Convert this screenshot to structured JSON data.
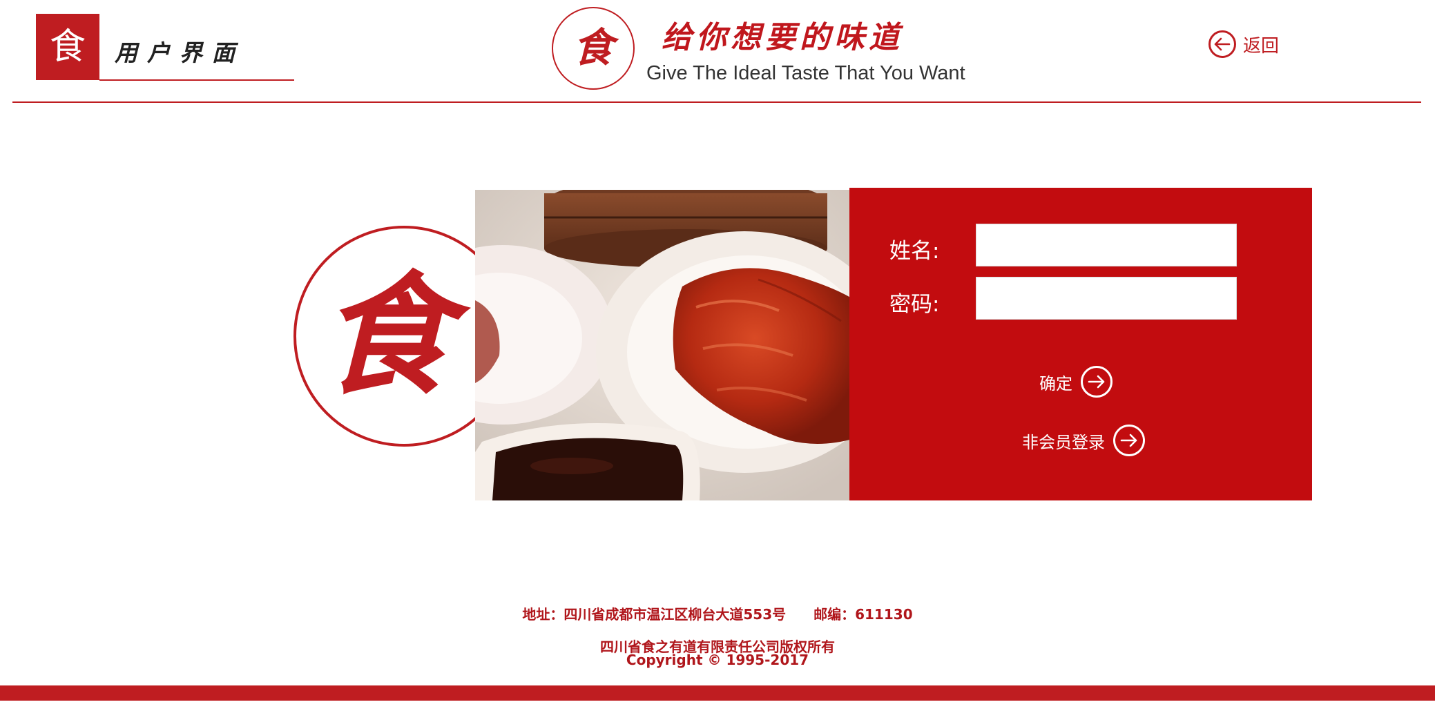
{
  "header": {
    "logo_char": "食",
    "section_title": "用户界面",
    "brand_char": "食",
    "slogan": "给你想要的味道",
    "slogan_en": "Give The Ideal Taste That You Want",
    "back_label": "返回",
    "back_icon": "arrow-left-circle-icon"
  },
  "seal": {
    "char": "食"
  },
  "photo": {
    "subject": "food-photo"
  },
  "login": {
    "name_label": "姓名:",
    "name_value": "",
    "password_label": "密码:",
    "password_value": "",
    "confirm_label": "确定",
    "confirm_icon": "arrow-right-circle-icon",
    "guest_label": "非会员登录",
    "guest_icon": "arrow-right-circle-icon"
  },
  "footer": {
    "address": "地址：四川省成都市温江区柳台大道553号　　邮编：611130",
    "company": "四川省食之有道有限责任公司版权所有",
    "copyright": "Copyright © 1995-2017"
  },
  "colors": {
    "brand_red": "#bf1d21",
    "panel_red": "#c20c0f",
    "white": "#ffffff"
  }
}
